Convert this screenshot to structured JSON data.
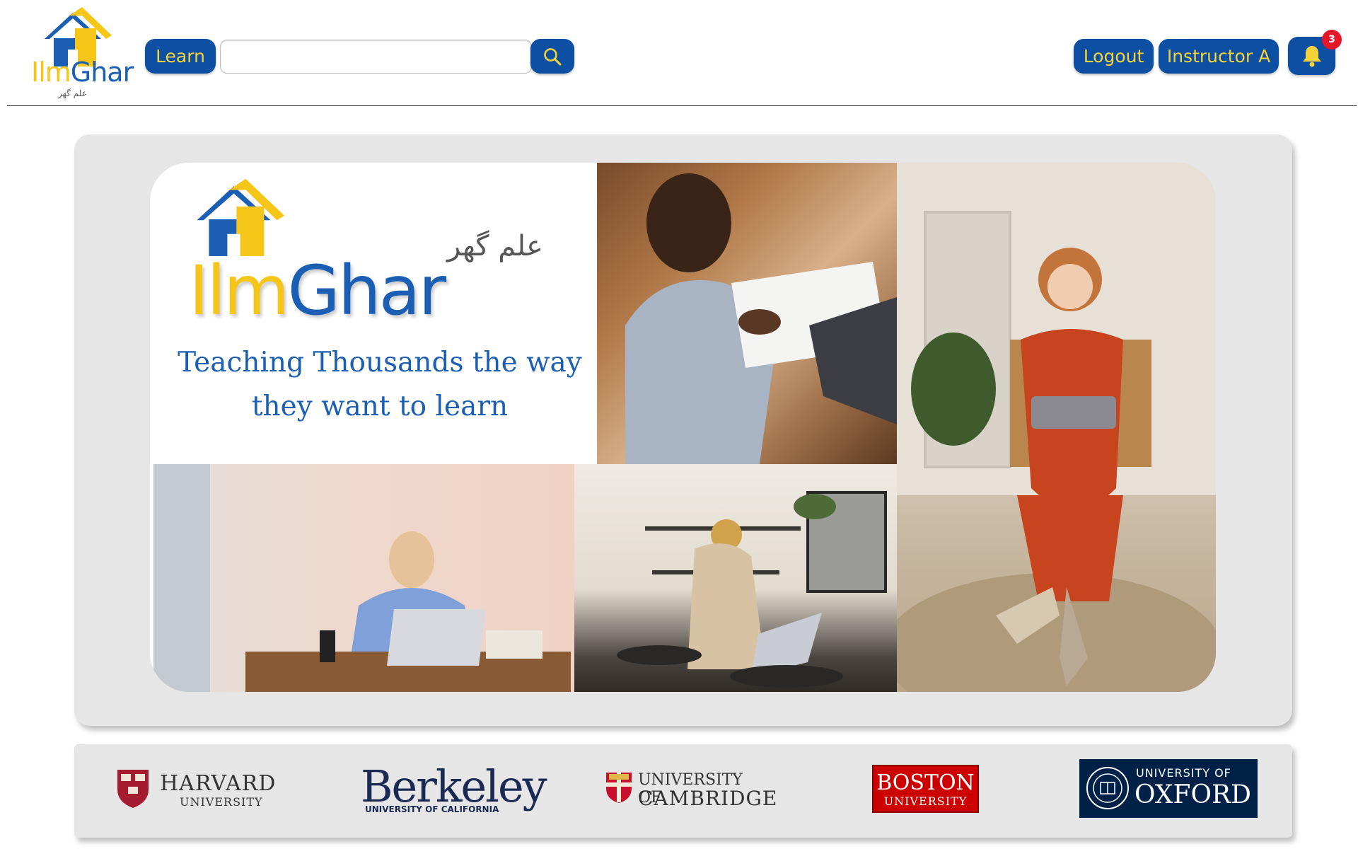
{
  "header": {
    "logo": {
      "word_ilm": "Ilm",
      "word_ghar": "Ghar",
      "subtitle_urdu": "علم گھر"
    },
    "learn_label": "Learn",
    "search": {
      "value": "",
      "placeholder": ""
    },
    "search_icon": "search-icon",
    "logout_label": "Logout",
    "instructor_label": "Instructor A",
    "bell_icon": "bell-icon",
    "notification_count": "3"
  },
  "hero": {
    "brand_ilm": "Ilm",
    "brand_ghar": "Ghar",
    "brand_urdu": "علم گھر",
    "tagline_line1": "Teaching Thousands the way",
    "tagline_line2": "they want to learn"
  },
  "universities": {
    "harvard_name": "HARVARD",
    "harvard_sub": "UNIVERSITY",
    "berkeley_name": "Berkeley",
    "berkeley_sub": "UNIVERSITY OF CALIFORNIA",
    "cambridge_line1": "UNIVERSITY OF",
    "cambridge_line2": "CAMBRIDGE",
    "boston_line1": "BOSTON",
    "boston_line2": "UNIVERSITY",
    "oxford_line1": "UNIVERSITY OF",
    "oxford_line2": "OXFORD"
  },
  "colors": {
    "brand_blue": "#0d4fa3",
    "brand_yellow": "#f5d13a",
    "badge_red": "#e5182b",
    "panel_gray": "#e6e6e6"
  }
}
